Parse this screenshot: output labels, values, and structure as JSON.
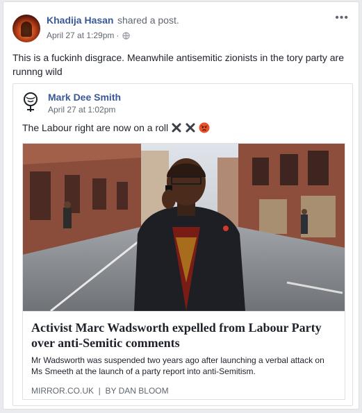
{
  "post": {
    "author": "Khadija Hasan",
    "action": "shared a post.",
    "timestamp": "April 27 at 1:29pm",
    "separator": "·",
    "privacy_icon": "globe-icon",
    "more_icon": "more-horizontal-icon",
    "text": "This is a fuckinh disgrace. Meanwhile antisemitic zionists in the tory party are runnng wild"
  },
  "shared": {
    "author": "Mark Dee Smith",
    "timestamp": "April 27 at 1:02pm",
    "text": "The Labour right are now on a roll",
    "emojis": [
      "cross-mark-icon",
      "cross-mark-icon",
      "angry-face-icon"
    ],
    "link": {
      "title": "Activist Marc Wadsworth expelled from Labour Party over anti-Semitic comments",
      "description": "Mr Wadsworth was suspended two years ago after launching a verbal attack on Ms Smeeth at the launch of a party report into anti-Semitism.",
      "domain": "MIRROR.CO.UK",
      "byline": "BY DAN BLOOM"
    }
  },
  "colors": {
    "link_blue": "#385898",
    "meta_gray": "#616770",
    "border": "#dddfe2"
  }
}
